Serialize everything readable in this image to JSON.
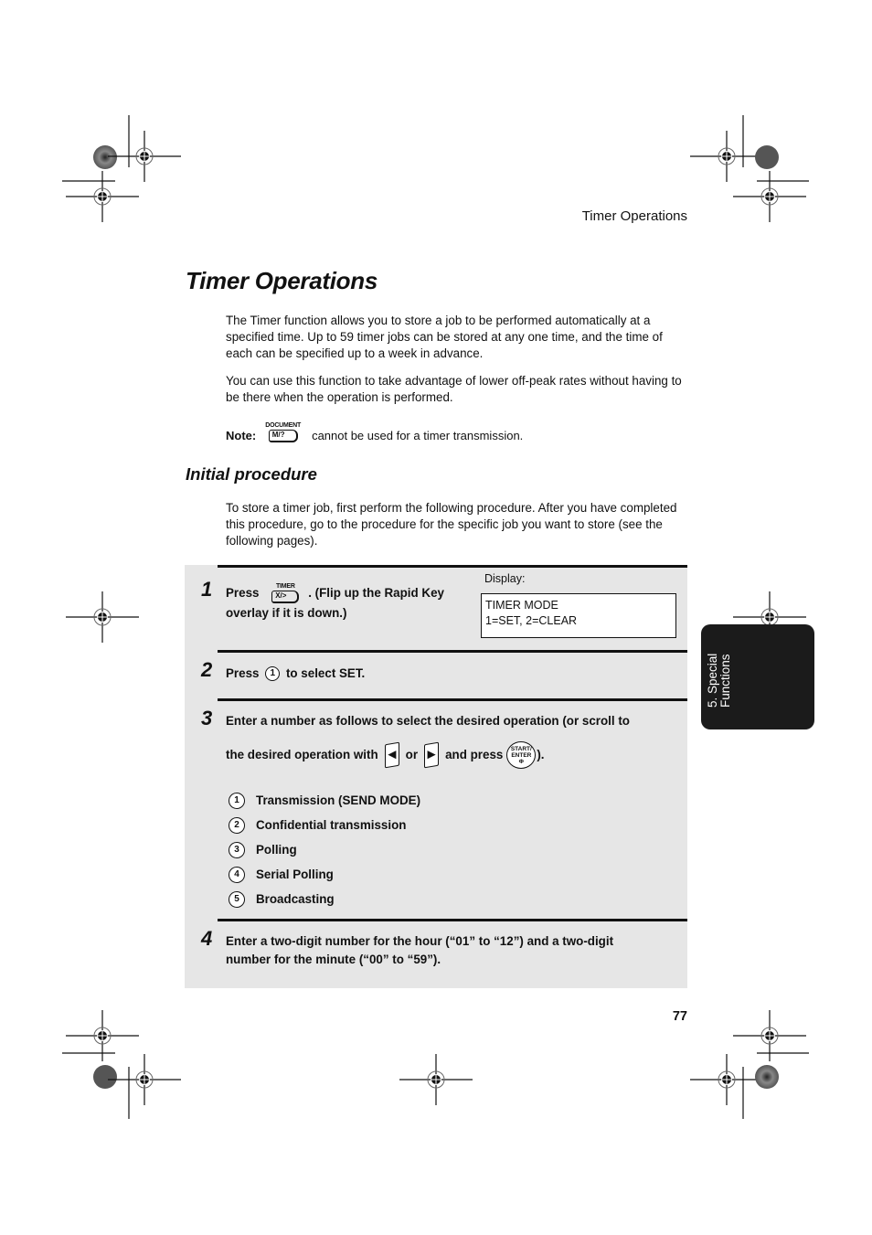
{
  "header": {
    "running_title": "Timer Operations"
  },
  "page": {
    "title": "Timer Operations",
    "intro_paragraphs": [
      "The Timer function allows you to store a job to be performed automatically at a specified time. Up to 59 timer jobs can be stored at any one time, and the time of each can be specified up to a week in advance.",
      "You can use this function to take advantage of lower off-peak rates without having to be there when the operation is performed."
    ],
    "note": {
      "label": "Note:",
      "key_top": "DOCUMENT",
      "key_label": "M/?",
      "text": "cannot be used for a timer transmission."
    },
    "section_title": "Initial procedure",
    "section_intro": "To store a timer job, first perform the following procedure. After you have completed this procedure, go to the procedure for the specific job you want to store (see the following pages).",
    "page_number": "77"
  },
  "steps": [
    {
      "number": "1",
      "press": "Press",
      "key_top": "TIMER",
      "key_label": "X/>",
      "text_after": ". (Flip up the Rapid Key",
      "text_line2": "overlay if it is down.)",
      "display_label": "Display:",
      "display_lines": [
        "TIMER MODE",
        "1=SET, 2=CLEAR"
      ]
    },
    {
      "number": "2",
      "press": "Press",
      "key": "1",
      "text_after": "to select SET."
    },
    {
      "number": "3",
      "line1": "Enter a number as follows to select the desired operation (or scroll to",
      "line2_a": "the desired operation with",
      "left_arrow": "◀",
      "or": "or",
      "right_arrow": "▶",
      "line2_b": "and press",
      "start_key_top": "START/",
      "start_key_mid": "ENTER",
      "start_key_icon": "Φ",
      "line2_end": ").",
      "options": [
        {
          "key": "1",
          "label": "Transmission (SEND MODE)"
        },
        {
          "key": "2",
          "label": "Confidential transmission"
        },
        {
          "key": "3",
          "label": "Polling"
        },
        {
          "key": "4",
          "label": "Serial Polling"
        },
        {
          "key": "5",
          "label": "Broadcasting"
        }
      ]
    },
    {
      "number": "4",
      "line1": "Enter a two-digit number for the hour (“01” to “12”) and a two-digit",
      "line2": "number for the minute (“00” to “59”)."
    }
  ],
  "side_tab": {
    "line1": "5. Special",
    "line2": "Functions"
  },
  "colors": {
    "procedure_bg": "#e6e6e6",
    "side_tab_bg": "#1b1b1b",
    "text": "#111111"
  }
}
